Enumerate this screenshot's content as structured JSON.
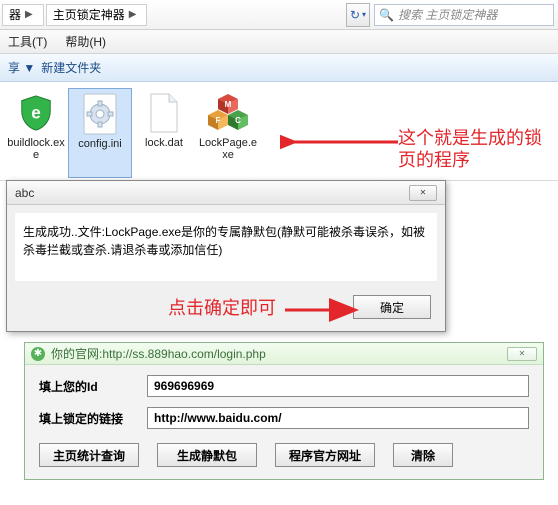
{
  "explorer": {
    "breadcrumb_prefix": "器",
    "breadcrumb_folder": "主页锁定神器",
    "search_placeholder": "搜索 主页锁定神器",
    "menu": {
      "tools": "工具(T)",
      "help": "帮助(H)"
    },
    "toolbar": {
      "share": "享 ▼",
      "new_folder": "新建文件夹"
    }
  },
  "files": [
    {
      "name": "buildlock.exe",
      "icon": "shield"
    },
    {
      "name": "config.ini",
      "icon": "gear"
    },
    {
      "name": "lock.dat",
      "icon": "doc"
    },
    {
      "name": "LockPage.exe",
      "icon": "cubes"
    }
  ],
  "annotations": {
    "note1_line1": "这个就是生成的锁",
    "note1_line2": "页的程序",
    "note2": "点击确定即可"
  },
  "dialog_abc": {
    "title": "abc",
    "message": "生成成功..文件:LockPage.exe是你的专属静默包(静默可能被杀毒误杀，如被杀毒拦截或查杀.请退杀毒或添加信任)",
    "ok": "确定"
  },
  "green_window": {
    "title": "你的官网:http://ss.889hao.com/login.php",
    "label_id": "填上您的Id",
    "value_id": "969696969",
    "label_url": "填上锁定的链接",
    "value_url": "http://www.baidu.com/",
    "buttons": {
      "stats": "主页统计查询",
      "build": "生成静默包",
      "official": "程序官方网址",
      "clear": "清除"
    }
  }
}
